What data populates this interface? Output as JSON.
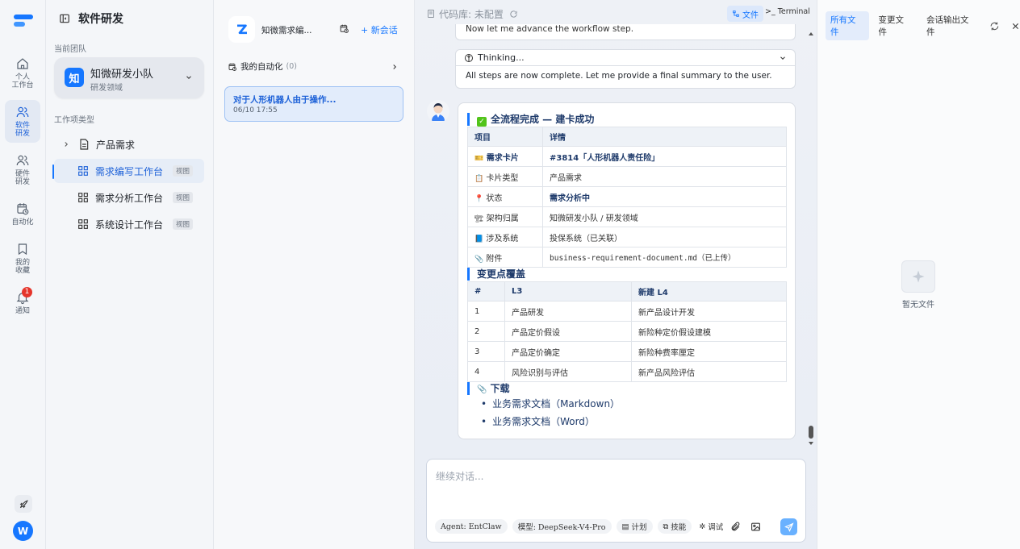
{
  "rail": {
    "items": [
      {
        "label": "个人\n工作台"
      },
      {
        "label": "软件\n研发"
      },
      {
        "label": "硬件\n研发"
      },
      {
        "label": "自动化"
      },
      {
        "label": "我的\n收藏"
      },
      {
        "label": "通知",
        "badge": "1"
      }
    ],
    "avatar": "W"
  },
  "sidebar": {
    "title": "软件研发",
    "team_caption": "当前团队",
    "team": {
      "initial": "知",
      "name": "知微研发小队",
      "sub": "研发领域"
    },
    "types_caption": "工作项类型",
    "items": [
      {
        "label": "产品需求"
      },
      {
        "label": "需求编写工作台",
        "tag": "视图"
      },
      {
        "label": "需求分析工作台",
        "tag": "视图"
      },
      {
        "label": "系统设计工作台",
        "tag": "视图"
      }
    ]
  },
  "convs": {
    "title": "知微需求编...",
    "new_label": "+ 新会话",
    "automation": {
      "label": "我的自动化",
      "count": "(0)"
    },
    "items": [
      {
        "title": "对于人形机器人由于操作...",
        "date": "06/10 17:55"
      }
    ]
  },
  "main": {
    "repo_label": "代码库: 未配置",
    "file_btn": "文件",
    "terminal_btn": "Terminal",
    "prev_msg": "Now let me advance the workflow step.",
    "thinking_label": "Thinking...",
    "thinking_text": "All steps are now complete. Let me provide a final summary to the user.",
    "card": {
      "heading": "全流程完成 — 建卡成功",
      "table1": {
        "headers": [
          "项目",
          "详情"
        ],
        "rows": [
          {
            "icon": "🎫",
            "key": "需求卡片",
            "val": "#3814「人形机器人责任险」"
          },
          {
            "icon": "📋",
            "key": "卡片类型",
            "val": "产品需求"
          },
          {
            "icon": "📍",
            "key": "状态",
            "val": "需求分析中"
          },
          {
            "icon": "🏗",
            "key": "架构归属",
            "val": "知微研发小队 / 研发领域"
          },
          {
            "icon": "📘",
            "key": "涉及系统",
            "val": "投保系统（已关联）"
          },
          {
            "icon": "📎",
            "key": "附件",
            "val": "business-requirement-document.md（已上传）"
          }
        ]
      },
      "section2": "变更点覆盖",
      "table2": {
        "headers": [
          "#",
          "L3",
          "新建 L4"
        ],
        "rows": [
          {
            "n": "1",
            "l3": "产品研发",
            "l4": "新产品设计开发"
          },
          {
            "n": "2",
            "l3": "产品定价假设",
            "l4": "新险种定价假设建模"
          },
          {
            "n": "3",
            "l3": "产品定价确定",
            "l4": "新险种费率厘定"
          },
          {
            "n": "4",
            "l3": "风险识别与评估",
            "l4": "新产品风险评估"
          }
        ]
      },
      "section3": "下载",
      "downloads": [
        "业务需求文档（Markdown）",
        "业务需求文档（Word）"
      ]
    },
    "input_placeholder": "继续对话...",
    "chips": [
      "Agent: EntClaw",
      "模型: DeepSeek-V4-Pro",
      "计划",
      "技能",
      "调试"
    ]
  },
  "right": {
    "tabs": [
      "所有文件",
      "变更文件",
      "会话输出文件"
    ],
    "empty": "暂无文件"
  },
  "colors": {
    "accent": "#1677ff",
    "badge": "#e5352b"
  }
}
